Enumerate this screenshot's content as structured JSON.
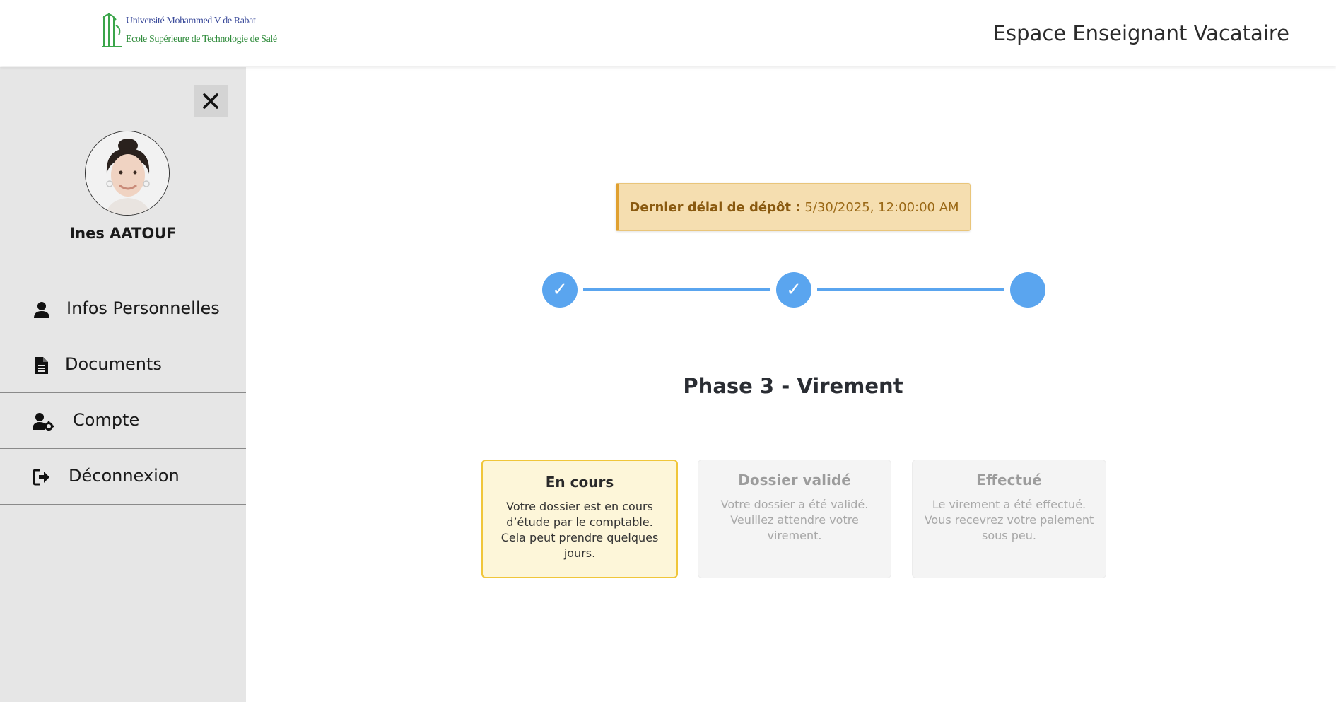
{
  "header": {
    "logo": {
      "line1": "Université Mohammed V de Rabat",
      "line2": "Ecole Supérieure de Technologie de Salé"
    },
    "title": "Espace Enseignant Vacataire"
  },
  "sidebar": {
    "close_icon": "close-icon",
    "user_name": "Ines AATOUF",
    "items": [
      {
        "label": "Infos Personnelles",
        "icon": "user-icon"
      },
      {
        "label": "Documents",
        "icon": "document-icon"
      },
      {
        "label": "Compte",
        "icon": "user-cog-icon"
      },
      {
        "label": "Déconnexion",
        "icon": "logout-icon"
      }
    ]
  },
  "main": {
    "deadline": {
      "label": "Dernier délai de dépôt :",
      "value": "5/30/2025, 12:00:00 AM"
    },
    "stepper": {
      "steps": [
        {
          "completed": true,
          "mark": "✓"
        },
        {
          "completed": true,
          "mark": "✓"
        },
        {
          "completed": false,
          "mark": ""
        }
      ],
      "color": "#5aa5ef"
    },
    "phase_title": "Phase 3 - Virement",
    "cards": [
      {
        "title": "En cours",
        "text": "Votre dossier est en cours d’étude par le comptable. Cela peut prendre quelques jours.",
        "state": "active"
      },
      {
        "title": "Dossier validé",
        "text": "Votre dossier a été validé. Veuillez attendre votre virement.",
        "state": "inactive"
      },
      {
        "title": "Effectué",
        "text": "Le virement a été effectué. Vous recevrez votre paiement sous peu.",
        "state": "inactive"
      }
    ]
  },
  "colors": {
    "accent": "#5aa5ef",
    "sidebar_bg": "#e6e6e6",
    "deadline_bg": "#f5deb0",
    "active_card_bg": "#fdf6d9",
    "active_card_border": "#f0c63a"
  }
}
